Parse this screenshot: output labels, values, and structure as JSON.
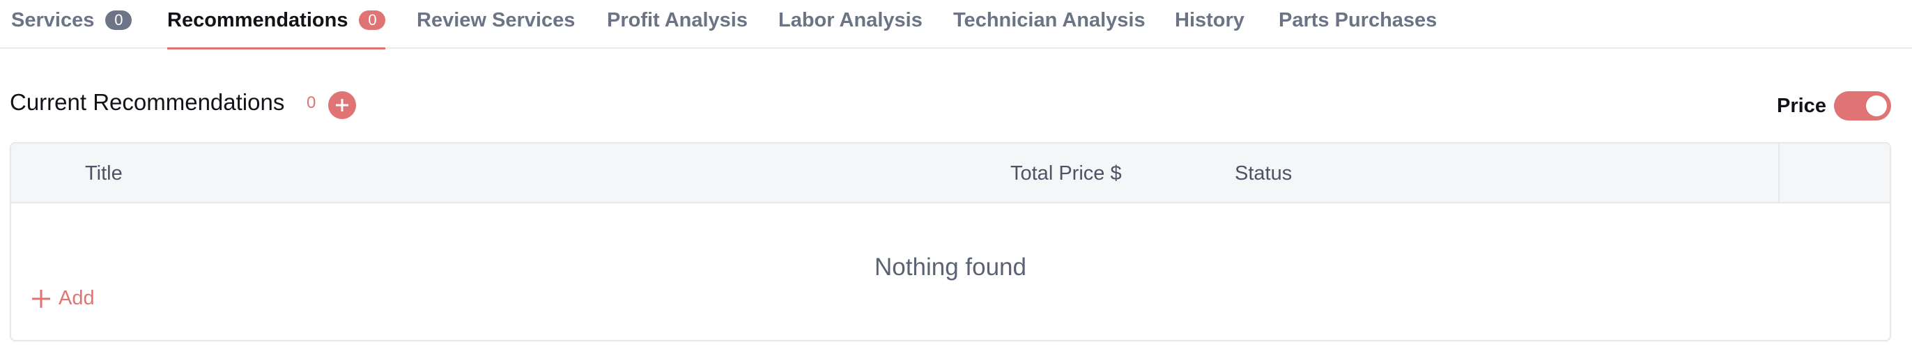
{
  "tabs": [
    {
      "label": "Services",
      "badge": "0",
      "active": false
    },
    {
      "label": "Recommendations",
      "badge": "0",
      "active": true
    },
    {
      "label": "Review Services",
      "active": false
    },
    {
      "label": "Profit Analysis",
      "active": false
    },
    {
      "label": "Labor Analysis",
      "active": false
    },
    {
      "label": "Technician Analysis",
      "active": false
    },
    {
      "label": "History",
      "active": false
    },
    {
      "label": "Parts Purchases",
      "active": false
    }
  ],
  "section": {
    "title": "Current Recommendations",
    "count": "0",
    "add_icon": "plus-circle-icon"
  },
  "price_toggle": {
    "label": "Price",
    "on": true
  },
  "table": {
    "columns": [
      "Title",
      "Total Price $",
      "Status"
    ],
    "empty_text": "Nothing found",
    "add_label": "Add",
    "add_icon": "plus-icon"
  },
  "colors": {
    "accent": "#e07373",
    "badge_gray": "#6e7487",
    "header_bg": "#f5f6f8",
    "border": "#e6e8ec"
  }
}
